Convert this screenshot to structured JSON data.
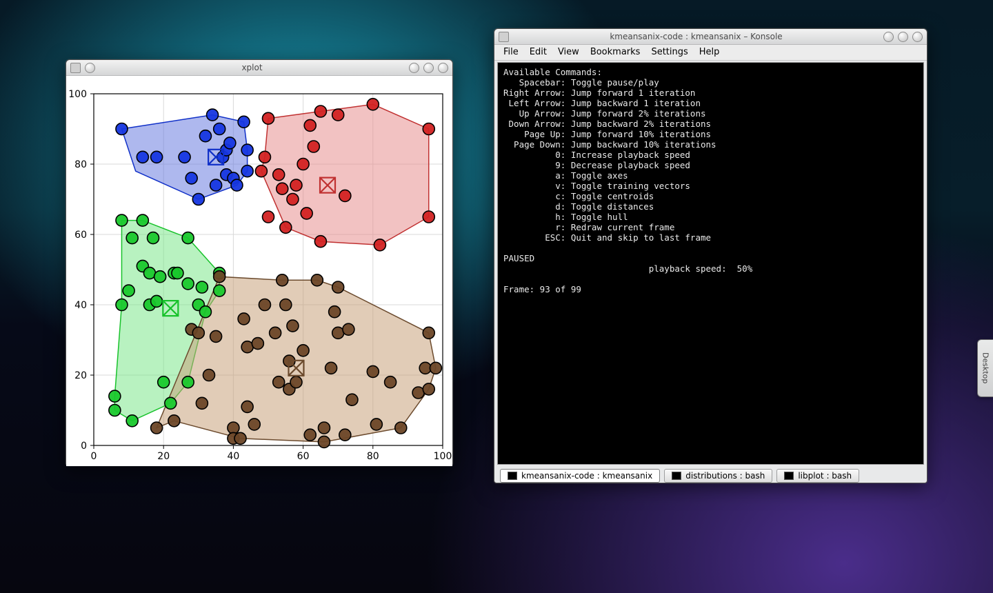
{
  "xplot": {
    "title": "xplot",
    "axes": {
      "x_ticks": [
        0,
        20,
        40,
        60,
        80,
        100
      ],
      "y_ticks": [
        0,
        20,
        40,
        60,
        80,
        100
      ]
    }
  },
  "konsole": {
    "title": "kmeansanix-code : kmeansanix – Konsole",
    "menus": [
      "File",
      "Edit",
      "View",
      "Bookmarks",
      "Settings",
      "Help"
    ],
    "tabs": [
      {
        "label": "kmeansanix-code : kmeansanix",
        "active": true
      },
      {
        "label": "distributions : bash",
        "active": false
      },
      {
        "label": "libplot : bash",
        "active": false
      }
    ],
    "header": "Available Commands:",
    "commands": [
      {
        "key": "Spacebar",
        "desc": "Toggle pause/play"
      },
      {
        "key": "Right Arrow",
        "desc": "Jump forward 1 iteration"
      },
      {
        "key": "Left Arrow",
        "desc": "Jump backward 1 iteration"
      },
      {
        "key": "Up Arrow",
        "desc": "Jump forward 2% iterations"
      },
      {
        "key": "Down Arrow",
        "desc": "Jump backward 2% iterations"
      },
      {
        "key": "Page Up",
        "desc": "Jump forward 10% iterations"
      },
      {
        "key": "Page Down",
        "desc": "Jump backward 10% iterations"
      },
      {
        "key": "0",
        "desc": "Increase playback speed"
      },
      {
        "key": "9",
        "desc": "Decrease playback speed"
      },
      {
        "key": "a",
        "desc": "Toggle axes"
      },
      {
        "key": "v",
        "desc": "Toggle training vectors"
      },
      {
        "key": "c",
        "desc": "Toggle centroids"
      },
      {
        "key": "d",
        "desc": "Toggle distances"
      },
      {
        "key": "h",
        "desc": "Toggle hull"
      },
      {
        "key": "r",
        "desc": "Redraw current frame"
      },
      {
        "key": "ESC",
        "desc": "Quit and skip to last frame"
      }
    ],
    "status_line": "PAUSED",
    "speed_line": "                            playback speed:  50%",
    "frame_line": "Frame: 93 of 99"
  },
  "side_tab": {
    "label": "Desktop"
  },
  "chart_data": {
    "type": "scatter",
    "title": "",
    "xlabel": "",
    "ylabel": "",
    "xlim": [
      0,
      100
    ],
    "ylim": [
      0,
      100
    ],
    "clusters": [
      {
        "name": "blue",
        "fill": "#6b7de0",
        "stroke": "#1030c8",
        "dot": "#1636e0",
        "centroid": [
          35,
          82
        ],
        "hull": [
          [
            8,
            90
          ],
          [
            34,
            94
          ],
          [
            43,
            92
          ],
          [
            44,
            84
          ],
          [
            44,
            78
          ],
          [
            41,
            74
          ],
          [
            30,
            70
          ],
          [
            12,
            78
          ]
        ],
        "points": [
          [
            8,
            90
          ],
          [
            14,
            82
          ],
          [
            18,
            82
          ],
          [
            26,
            82
          ],
          [
            28,
            76
          ],
          [
            30,
            70
          ],
          [
            32,
            88
          ],
          [
            34,
            94
          ],
          [
            35,
            74
          ],
          [
            36,
            90
          ],
          [
            37,
            82
          ],
          [
            38,
            84
          ],
          [
            38,
            77
          ],
          [
            39,
            86
          ],
          [
            40,
            76
          ],
          [
            41,
            74
          ],
          [
            43,
            92
          ],
          [
            44,
            84
          ],
          [
            44,
            78
          ]
        ]
      },
      {
        "name": "red",
        "fill": "#e88f8f",
        "stroke": "#c03030",
        "dot": "#d22222",
        "centroid": [
          67,
          74
        ],
        "hull": [
          [
            50,
            93
          ],
          [
            65,
            95
          ],
          [
            80,
            97
          ],
          [
            96,
            90
          ],
          [
            96,
            65
          ],
          [
            82,
            57
          ],
          [
            65,
            58
          ],
          [
            55,
            62
          ],
          [
            48,
            78
          ],
          [
            49,
            82
          ]
        ],
        "points": [
          [
            48,
            78
          ],
          [
            49,
            82
          ],
          [
            50,
            65
          ],
          [
            50,
            93
          ],
          [
            53,
            77
          ],
          [
            54,
            73
          ],
          [
            55,
            62
          ],
          [
            57,
            70
          ],
          [
            58,
            74
          ],
          [
            60,
            80
          ],
          [
            61,
            66
          ],
          [
            62,
            91
          ],
          [
            63,
            85
          ],
          [
            65,
            58
          ],
          [
            65,
            95
          ],
          [
            70,
            94
          ],
          [
            72,
            71
          ],
          [
            80,
            97
          ],
          [
            82,
            57
          ],
          [
            96,
            65
          ],
          [
            96,
            90
          ]
        ]
      },
      {
        "name": "green",
        "fill": "#7ee88c",
        "stroke": "#17c22a",
        "dot": "#19c82c",
        "centroid": [
          22,
          39
        ],
        "hull": [
          [
            8,
            64
          ],
          [
            14,
            64
          ],
          [
            27,
            59
          ],
          [
            36,
            49
          ],
          [
            36,
            44
          ],
          [
            32,
            38
          ],
          [
            27,
            18
          ],
          [
            22,
            12
          ],
          [
            11,
            7
          ],
          [
            6,
            10
          ],
          [
            6,
            14
          ],
          [
            8,
            40
          ]
        ],
        "points": [
          [
            6,
            10
          ],
          [
            6,
            14
          ],
          [
            8,
            40
          ],
          [
            8,
            64
          ],
          [
            10,
            44
          ],
          [
            11,
            7
          ],
          [
            11,
            59
          ],
          [
            14,
            64
          ],
          [
            14,
            51
          ],
          [
            16,
            40
          ],
          [
            16,
            49
          ],
          [
            17,
            59
          ],
          [
            18,
            41
          ],
          [
            19,
            48
          ],
          [
            20,
            18
          ],
          [
            22,
            12
          ],
          [
            23,
            49
          ],
          [
            24,
            49
          ],
          [
            27,
            18
          ],
          [
            27,
            46
          ],
          [
            27,
            59
          ],
          [
            30,
            40
          ],
          [
            31,
            45
          ],
          [
            32,
            38
          ],
          [
            36,
            44
          ],
          [
            36,
            49
          ]
        ]
      },
      {
        "name": "brown",
        "fill": "#c8a27c",
        "stroke": "#6b4a2d",
        "dot": "#6c4627",
        "centroid": [
          58,
          22
        ],
        "hull": [
          [
            18,
            5
          ],
          [
            36,
            48
          ],
          [
            54,
            47
          ],
          [
            64,
            47
          ],
          [
            70,
            45
          ],
          [
            96,
            32
          ],
          [
            98,
            22
          ],
          [
            96,
            16
          ],
          [
            88,
            5
          ],
          [
            66,
            1
          ],
          [
            42,
            2
          ],
          [
            23,
            7
          ]
        ],
        "points": [
          [
            18,
            5
          ],
          [
            23,
            7
          ],
          [
            28,
            33
          ],
          [
            30,
            32
          ],
          [
            31,
            12
          ],
          [
            33,
            20
          ],
          [
            35,
            31
          ],
          [
            36,
            48
          ],
          [
            40,
            5
          ],
          [
            40,
            2
          ],
          [
            42,
            2
          ],
          [
            43,
            36
          ],
          [
            44,
            28
          ],
          [
            44,
            11
          ],
          [
            46,
            6
          ],
          [
            47,
            29
          ],
          [
            49,
            40
          ],
          [
            52,
            32
          ],
          [
            53,
            18
          ],
          [
            54,
            47
          ],
          [
            55,
            40
          ],
          [
            56,
            16
          ],
          [
            56,
            24
          ],
          [
            57,
            34
          ],
          [
            58,
            18
          ],
          [
            60,
            27
          ],
          [
            62,
            3
          ],
          [
            64,
            47
          ],
          [
            66,
            1
          ],
          [
            66,
            5
          ],
          [
            68,
            22
          ],
          [
            69,
            38
          ],
          [
            70,
            45
          ],
          [
            70,
            32
          ],
          [
            72,
            3
          ],
          [
            73,
            33
          ],
          [
            74,
            13
          ],
          [
            80,
            21
          ],
          [
            81,
            6
          ],
          [
            85,
            18
          ],
          [
            88,
            5
          ],
          [
            93,
            15
          ],
          [
            95,
            22
          ],
          [
            96,
            16
          ],
          [
            96,
            32
          ],
          [
            98,
            22
          ]
        ]
      }
    ]
  }
}
